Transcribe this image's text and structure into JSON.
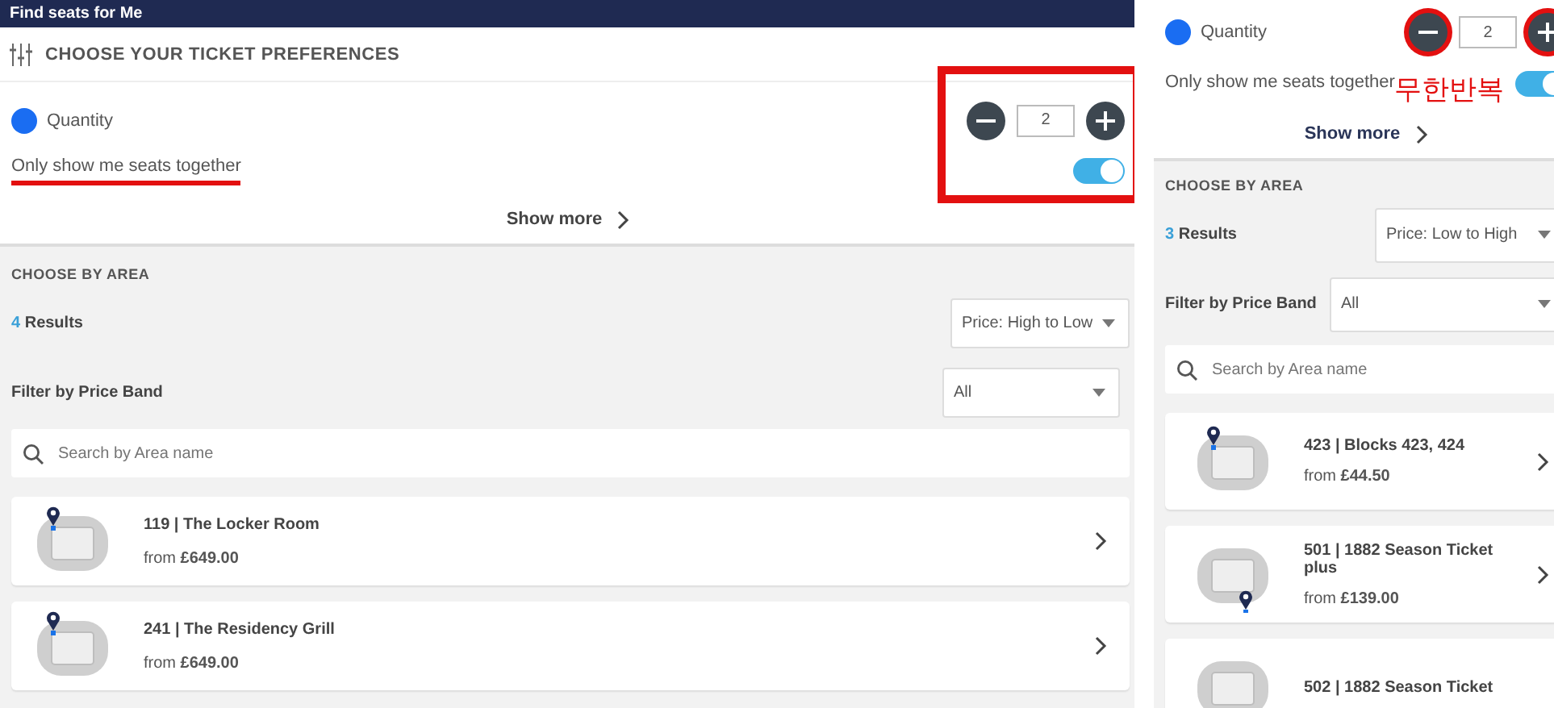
{
  "left": {
    "header_title": "Find seats for Me",
    "preferences": {
      "title": "CHOOSE YOUR TICKET PREFERENCES",
      "quantity_label": "Quantity",
      "quantity": "2",
      "together_label": "Only show me seats together",
      "together_on": true,
      "together_underlined": true,
      "controls_boxed": true,
      "show_more": "Show more"
    },
    "area": {
      "title": "CHOOSE BY AREA",
      "count": "4",
      "results_label": "Results",
      "sort": "Price: High to Low",
      "filter_label": "Filter by Price Band",
      "filter": "All",
      "search_placeholder": "Search by Area name",
      "areas": [
        {
          "code": "119 |",
          "name": "The Locker Room",
          "from": "from",
          "price": "£649.00",
          "kind": "pinned-top"
        },
        {
          "code": "241 |",
          "name": "The Residency Grill",
          "from": "from",
          "price": "£649.00",
          "kind": "pinned-top"
        }
      ]
    }
  },
  "right": {
    "preferences": {
      "quantity_label": "Quantity",
      "quantity": "2",
      "together_label": "Only show me seats together",
      "together_on": true,
      "buttons_circled": true,
      "show_more": "Show more"
    },
    "annotation": "무한반복",
    "area": {
      "title": "CHOOSE BY AREA",
      "count": "3",
      "results_label": "Results",
      "sort": "Price: Low to High",
      "filter_label": "Filter by Price Band",
      "filter": "All",
      "search_placeholder": "Search by Area name",
      "areas": [
        {
          "code": "423 |",
          "name": "Blocks 423, 424",
          "from": "from",
          "price": "£44.50",
          "kind": "pinned-top"
        },
        {
          "code": "501 |",
          "name": "1882 Season Ticket plus",
          "from": "from",
          "price": "£139.00",
          "kind": "pinned-bottom"
        },
        {
          "code": "502 |",
          "name": "1882 Season Ticket",
          "kind": "plain"
        }
      ]
    }
  }
}
